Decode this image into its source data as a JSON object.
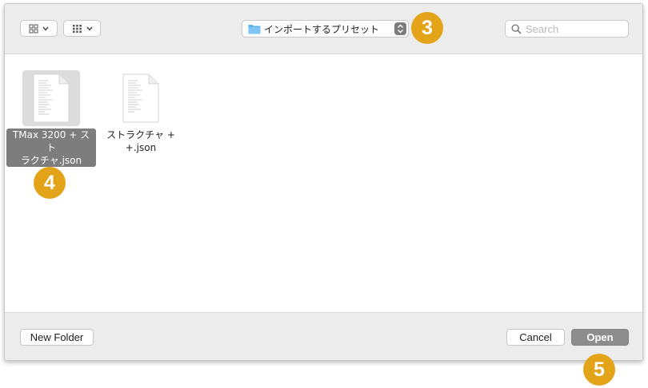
{
  "toolbar": {
    "view_icon_mode": "icon-view-grid-icon",
    "view_group_mode": "group-grid-icon",
    "location": {
      "icon": "folder-icon",
      "label": "インポートするプリセット",
      "stepper_icon": "updown-chevron-icon"
    },
    "search": {
      "icon": "search-icon",
      "placeholder": "Search",
      "value": ""
    }
  },
  "files": [
    {
      "name_line1": "TMax 3200 + スト",
      "name_line2": "ラクチャ.json",
      "selected": true,
      "icon": "json-document-icon"
    },
    {
      "name_line1": "ストラクチャ +",
      "name_line2": "+.json",
      "selected": false,
      "icon": "json-document-icon"
    }
  ],
  "footer": {
    "new_folder_label": "New Folder",
    "cancel_label": "Cancel",
    "open_label": "Open"
  },
  "callouts": [
    "3",
    "4",
    "5"
  ],
  "colors": {
    "callout": "#e3a419",
    "selection": "#7d7d7d",
    "open_button": "#8d8d8d",
    "chrome_bg": "#ececec",
    "folder_blue": "#5ab3ef"
  }
}
